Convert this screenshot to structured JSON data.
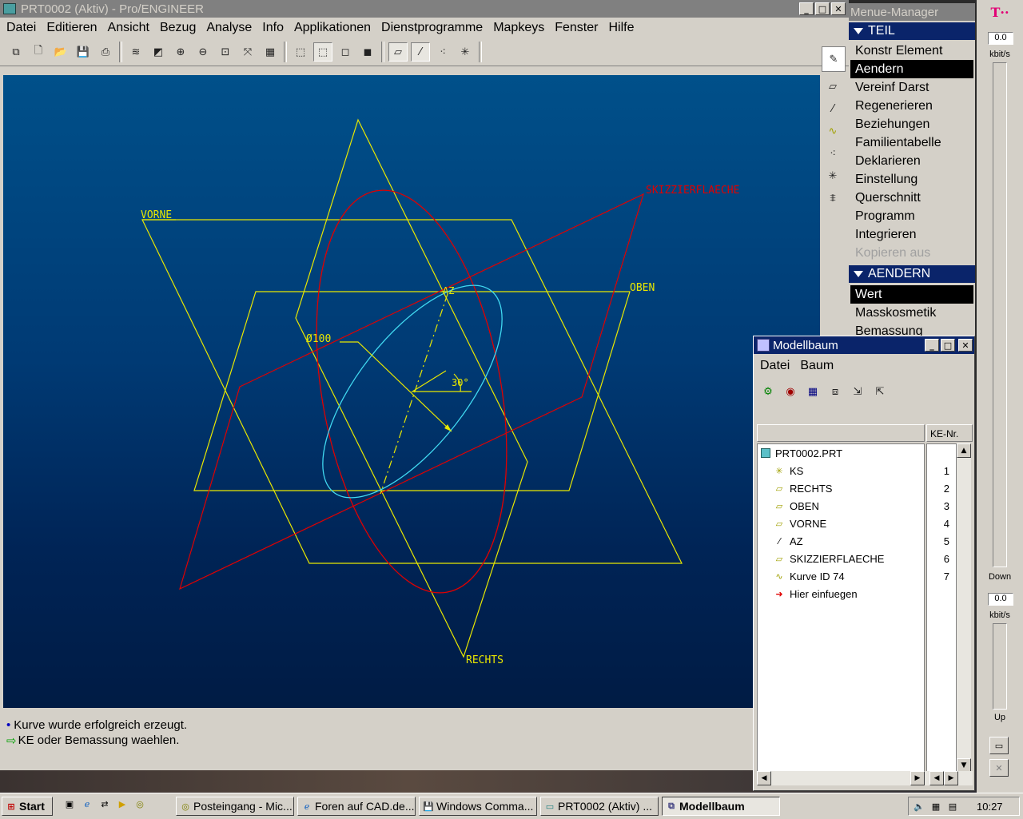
{
  "main_window": {
    "title": "PRT0002 (Aktiv) - Pro/ENGINEER",
    "menus": [
      "Datei",
      "Editieren",
      "Ansicht",
      "Bezug",
      "Analyse",
      "Info",
      "Applikationen",
      "Dienstprogramme",
      "Mapkeys",
      "Fenster",
      "Hilfe"
    ],
    "toolbar_icons": [
      "select-window-icon",
      "new-file-icon",
      "open-file-icon",
      "save-icon",
      "print-icon",
      "layers-icon",
      "repaint-icon",
      "zoom-in-icon",
      "zoom-out-icon",
      "zoom-fit-icon",
      "orient-icon",
      "saved-views-icon",
      "wireframe-icon",
      "hidden-line-icon",
      "no-hidden-icon",
      "shaded-icon",
      "datum-planes-icon",
      "datum-axes-icon",
      "datum-points-icon",
      "coordinate-systems-icon"
    ],
    "messages": [
      "Kurve wurde erfolgreich erzeugt.",
      "KE oder Bemassung waehlen."
    ]
  },
  "viewport": {
    "labels": {
      "vorne": "VORNE",
      "oben": "OBEN",
      "rechts": "RECHTS",
      "skizzier": "SKIZZIERFLAECHE",
      "az": "AZ",
      "dim_diameter": "Ø100",
      "dim_angle": "30°"
    },
    "colors": {
      "datum": "#e8e800",
      "sketch": "#e00000",
      "curve": "#40d8f0",
      "background_top": "#00508a",
      "background_bottom": "#001b44"
    }
  },
  "menu_manager": {
    "title": "Menue-Manager",
    "section1": "TEIL",
    "items1": [
      {
        "label": "Konstr Element",
        "state": "normal"
      },
      {
        "label": "Aendern",
        "state": "selected"
      },
      {
        "label": "Vereinf Darst",
        "state": "normal"
      },
      {
        "label": "Regenerieren",
        "state": "normal"
      },
      {
        "label": "Beziehungen",
        "state": "normal"
      },
      {
        "label": "Familientabelle",
        "state": "normal"
      },
      {
        "label": "Deklarieren",
        "state": "normal"
      },
      {
        "label": "Einstellung",
        "state": "normal"
      },
      {
        "label": "Querschnitt",
        "state": "normal"
      },
      {
        "label": "Programm",
        "state": "normal"
      },
      {
        "label": "Integrieren",
        "state": "normal"
      },
      {
        "label": "Kopieren aus",
        "state": "disabled"
      }
    ],
    "section2": "AENDERN",
    "items2": [
      {
        "label": "Wert",
        "state": "selected"
      },
      {
        "label": "Masskosmetik",
        "state": "normal"
      },
      {
        "label": "Bemassung",
        "state": "normal"
      }
    ]
  },
  "model_tree": {
    "title": "Modellbaum",
    "menus": [
      "Datei",
      "Baum"
    ],
    "column_header": "KE-Nr.",
    "root": "PRT0002.PRT",
    "rows": [
      {
        "name": "KS",
        "nr": "1",
        "icon": "csys-icon"
      },
      {
        "name": "RECHTS",
        "nr": "2",
        "icon": "datum-plane-icon"
      },
      {
        "name": "OBEN",
        "nr": "3",
        "icon": "datum-plane-icon"
      },
      {
        "name": "VORNE",
        "nr": "4",
        "icon": "datum-plane-icon"
      },
      {
        "name": "AZ",
        "nr": "5",
        "icon": "datum-axis-icon"
      },
      {
        "name": "SKIZZIERFLAECHE",
        "nr": "6",
        "icon": "datum-plane-icon"
      },
      {
        "name": "Kurve ID 74",
        "nr": "7",
        "icon": "curve-icon"
      },
      {
        "name": "Hier einfuegen",
        "nr": "",
        "icon": "insert-arrow-icon"
      }
    ]
  },
  "meter": {
    "brand": "T··",
    "down_value": "0.0",
    "down_unit": "kbit/s",
    "down_label": "Down",
    "up_value": "0.0",
    "up_unit": "kbit/s",
    "up_label": "Up"
  },
  "taskbar": {
    "start": "Start",
    "buttons": [
      {
        "label": "Posteingang - Mic...",
        "active": false
      },
      {
        "label": "Foren auf CAD.de...",
        "active": false
      },
      {
        "label": "Windows Comma...",
        "active": false
      },
      {
        "label": "PRT0002 (Aktiv) ...",
        "active": false
      },
      {
        "label": "Modellbaum",
        "active": true
      }
    ],
    "clock": "10:27"
  }
}
